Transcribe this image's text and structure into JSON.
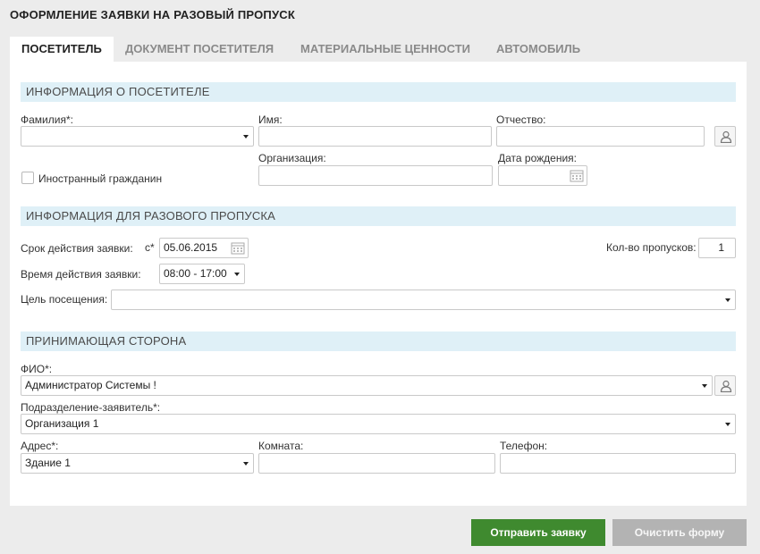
{
  "page_title": "ОФОРМЛЕНИЕ ЗАЯВКИ НА РАЗОВЫЙ ПРОПУСК",
  "tabs": [
    {
      "label": "ПОСЕТИТЕЛЬ",
      "active": true
    },
    {
      "label": "ДОКУМЕНТ ПОСЕТИТЕЛЯ",
      "active": false
    },
    {
      "label": "МАТЕРИАЛЬНЫЕ ЦЕННОСТИ",
      "active": false
    },
    {
      "label": "АВТОМОБИЛЬ",
      "active": false
    }
  ],
  "visitor": {
    "header": "ИНФОРМАЦИЯ О ПОСЕТИТЕЛЕ",
    "lastname_label": "Фамилия*:",
    "lastname_value": "",
    "firstname_label": "Имя:",
    "firstname_value": "",
    "patronymic_label": "Отчество:",
    "patronymic_value": "",
    "foreign_label": "Иностранный гражданин",
    "foreign_checked": false,
    "organization_label": "Организация:",
    "organization_value": "",
    "birthdate_label": "Дата рождения:",
    "birthdate_value": ""
  },
  "pass": {
    "header": "ИНФОРМАЦИЯ ДЛЯ РАЗОВОГО ПРОПУСКА",
    "validity_label": "Срок действия заявки:",
    "from_label": "с*",
    "from_date": "05.06.2015",
    "count_label": "Кол-во пропусков:",
    "count_value": "1",
    "time_label": "Время действия заявки:",
    "time_value": "08:00 - 17:00",
    "purpose_label": "Цель посещения:",
    "purpose_value": ""
  },
  "host": {
    "header": "ПРИНИМАЮЩАЯ СТОРОНА",
    "fio_label": "ФИО*:",
    "fio_value": "Администратор Системы !",
    "department_label": "Подразделение-заявитель*:",
    "department_value": "Организация 1",
    "address_label": "Адрес*:",
    "address_value": "Здание 1",
    "room_label": "Комната:",
    "room_value": "",
    "phone_label": "Телефон:",
    "phone_value": ""
  },
  "actions": {
    "submit_label": "Отправить заявку",
    "clear_label": "Очистить форму"
  },
  "colors": {
    "submit": "#3f8a2f",
    "clear": "#b3b3b3",
    "section_header": "#dff0f7"
  },
  "icons": {
    "user_picker": "user-icon",
    "calendar": "calendar-icon",
    "dropdown": "chevron-down-icon"
  }
}
